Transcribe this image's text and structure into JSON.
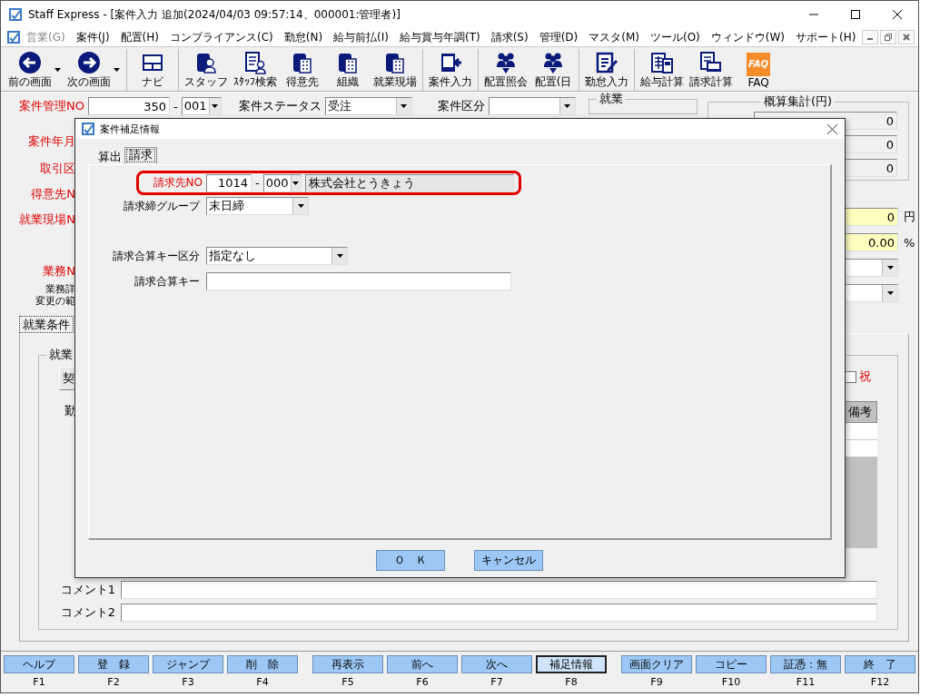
{
  "window": {
    "title": "Staff Express - [案件入力  追加(2024/04/03 09:57:14、000001:管理者)]"
  },
  "menu": [
    {
      "label": "営業(G)",
      "disabled": true
    },
    {
      "label": "案件(J)",
      "disabled": false
    },
    {
      "label": "配置(H)",
      "disabled": false
    },
    {
      "label": "コンプライアンス(C)",
      "disabled": false
    },
    {
      "label": "勤怠(N)",
      "disabled": false
    },
    {
      "label": "給与前払(I)",
      "disabled": false
    },
    {
      "label": "給与賞与年調(T)",
      "disabled": false
    },
    {
      "label": "請求(S)",
      "disabled": false
    },
    {
      "label": "管理(D)",
      "disabled": false
    },
    {
      "label": "マスタ(M)",
      "disabled": false
    },
    {
      "label": "ツール(O)",
      "disabled": false
    },
    {
      "label": "ウィンドウ(W)",
      "disabled": false
    },
    {
      "label": "サポート(H)",
      "disabled": false
    }
  ],
  "toolbar": [
    [
      {
        "label": "前の画面",
        "kind": "back",
        "dropdown": true
      },
      {
        "label": "次の画面",
        "kind": "forward",
        "dropdown": true
      }
    ],
    [
      {
        "label": "ナビ",
        "kind": "navi",
        "dropdown": false
      }
    ],
    [
      {
        "label": "スタッフ",
        "kind": "staff",
        "dropdown": false
      },
      {
        "label": "ｽﾀｯﾌ検索",
        "kind": "search",
        "dropdown": false
      },
      {
        "label": "得意先",
        "kind": "building",
        "dropdown": false
      },
      {
        "label": "組織",
        "kind": "building",
        "dropdown": false
      },
      {
        "label": "就業現場",
        "kind": "building",
        "dropdown": false
      }
    ],
    [
      {
        "label": "案件入力",
        "kind": "input",
        "dropdown": false
      }
    ],
    [
      {
        "label": "配置照会",
        "kind": "people",
        "dropdown": false
      },
      {
        "label": "配置(日",
        "kind": "people",
        "dropdown": false
      }
    ],
    [
      {
        "label": "勤怠入力",
        "kind": "pen",
        "dropdown": false
      }
    ],
    [
      {
        "label": "給与計算",
        "kind": "calc",
        "dropdown": false
      },
      {
        "label": "請求計算",
        "kind": "bill",
        "dropdown": false
      },
      {
        "label": "FAQ",
        "kind": "faq",
        "logo": "FAQ",
        "dropdown": false
      }
    ]
  ],
  "form": {
    "case_no": {
      "label": "案件管理NO",
      "required": true,
      "value": "350",
      "separator": "-",
      "branch": "001"
    },
    "status": {
      "label": "案件ステータス",
      "value": "受注"
    },
    "category": {
      "label": "案件区分"
    },
    "employment": {
      "label": "就業"
    },
    "labels": [
      {
        "text": "案件年月",
        "required": true
      },
      {
        "text": "取引区",
        "required": true
      },
      {
        "text": "得意先N",
        "required": true
      },
      {
        "text": "就業現場N",
        "required": true
      }
    ],
    "work": {
      "text": "業務N",
      "required": true
    },
    "work_detail": [
      "業務詳",
      "変更の範"
    ],
    "summary": {
      "title": "概算集計(円)",
      "values": [
        "0",
        "0",
        "0"
      ]
    },
    "amount": {
      "value": "0",
      "unit": "円"
    },
    "rate": {
      "value": "0.00",
      "unit": "%"
    },
    "tab": {
      "label": "就業条件"
    },
    "group": {
      "label": "就業"
    },
    "contract_button": "契",
    "attendance_label": "勤",
    "holiday": {
      "label": "祝",
      "checked": false
    },
    "grid": {
      "column": "備考"
    },
    "comments": [
      {
        "label": "コメント1"
      },
      {
        "label": "コメント2"
      }
    ]
  },
  "dialog": {
    "title": "案件補足情報",
    "tabs": [
      {
        "label": "算出",
        "selected": false
      },
      {
        "label": "請求",
        "selected": true
      }
    ],
    "billing_no": {
      "label": "請求先NO",
      "required": true,
      "highlighted": true,
      "value": "1014",
      "separator": "-",
      "branch": "000",
      "name": "株式会社とうきょう"
    },
    "closing_group": {
      "label": "請求締グループ",
      "value": "末日締"
    },
    "sum_key_type": {
      "label": "請求合算キー区分",
      "value": "指定なし"
    },
    "sum_key": {
      "label": "請求合算キー"
    },
    "buttons": [
      "Ｏ　Ｋ",
      "キャンセル"
    ]
  },
  "function_keys": [
    {
      "label": "ヘルプ",
      "key": "F1",
      "selected": false
    },
    {
      "label": "登　録",
      "key": "F2",
      "selected": false
    },
    {
      "label": "ジャンプ",
      "key": "F3",
      "selected": false
    },
    {
      "label": "削　除",
      "key": "F4",
      "selected": false
    },
    {
      "label": "再表示",
      "key": "F5",
      "selected": false
    },
    {
      "label": "前へ",
      "key": "F6",
      "selected": false
    },
    {
      "label": "次へ",
      "key": "F7",
      "selected": false
    },
    {
      "label": "補足情報",
      "key": "F8",
      "selected": true
    },
    {
      "label": "画面クリア",
      "key": "F9",
      "selected": false
    },
    {
      "label": "コピー",
      "key": "F10",
      "selected": false
    },
    {
      "label": "証憑：無",
      "key": "F11",
      "selected": false
    },
    {
      "label": "終　了",
      "key": "F12",
      "selected": false
    }
  ]
}
